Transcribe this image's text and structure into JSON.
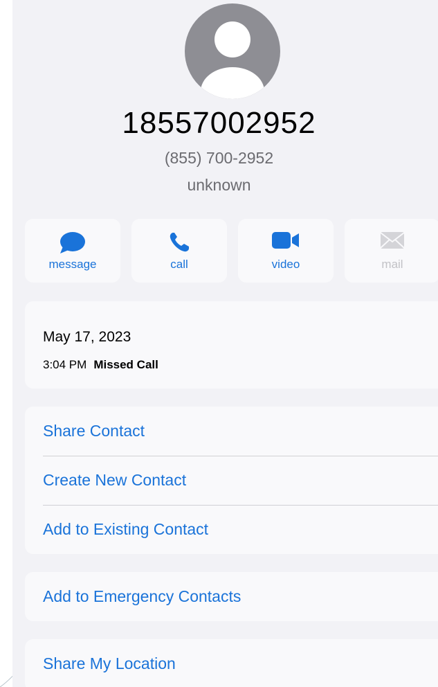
{
  "contact": {
    "name": "18557002952",
    "formatted_number": "(855) 700-2952",
    "label": "unknown"
  },
  "actions": [
    {
      "label": "message",
      "icon": "message-bubble-icon",
      "enabled": true
    },
    {
      "label": "call",
      "icon": "phone-icon",
      "enabled": true
    },
    {
      "label": "video",
      "icon": "video-camera-icon",
      "enabled": true
    },
    {
      "label": "mail",
      "icon": "envelope-icon",
      "enabled": false
    }
  ],
  "call_log": {
    "date": "May 17, 2023",
    "time": "3:04 PM",
    "status": "Missed Call"
  },
  "options_group": [
    "Share Contact",
    "Create New Contact",
    "Add to Existing Contact"
  ],
  "emergency": "Add to Emergency Contacts",
  "location": "Share My Location",
  "colors": {
    "accent": "#1a73d9",
    "background": "#f2f2f6",
    "card": "#f9f9fb",
    "avatar": "#8e8e94"
  }
}
